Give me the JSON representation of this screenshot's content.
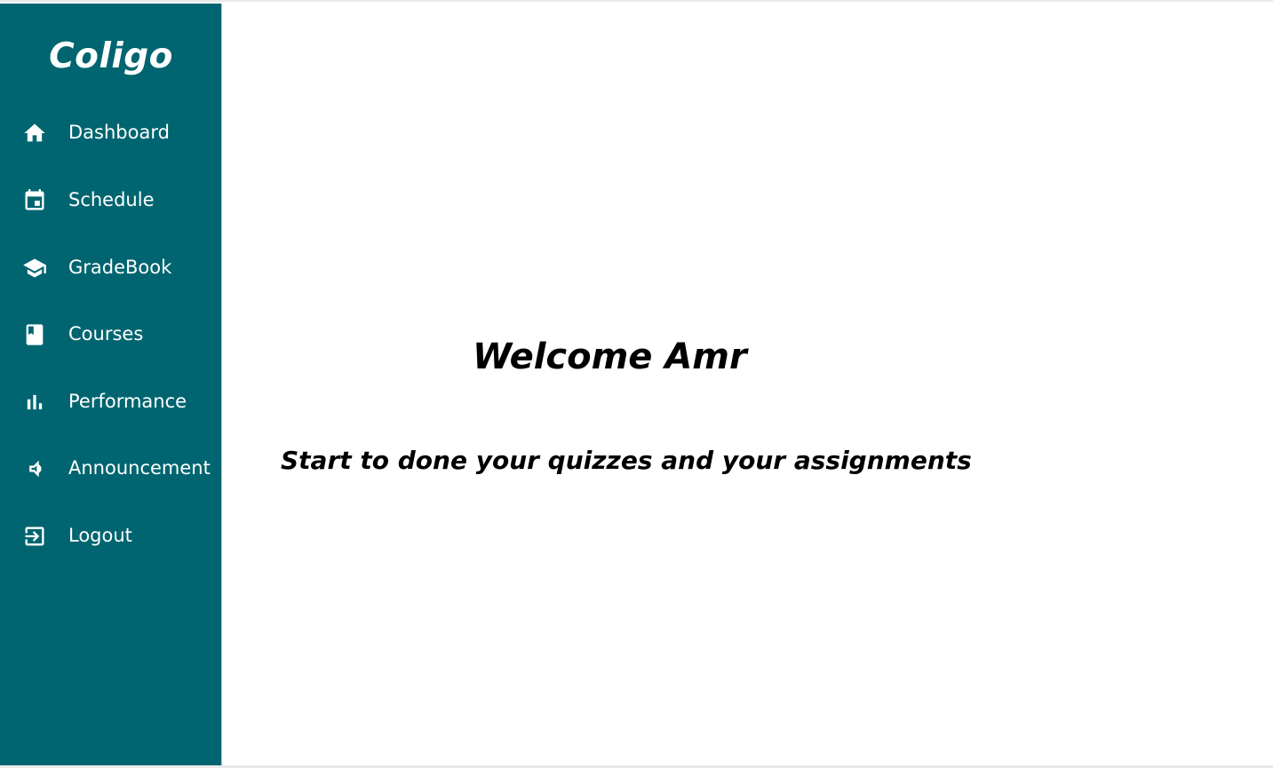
{
  "brand": {
    "name": "Coligo"
  },
  "sidebar": {
    "items": [
      {
        "label": "Dashboard",
        "icon": "home-icon"
      },
      {
        "label": "Schedule",
        "icon": "calendar-icon"
      },
      {
        "label": "GradeBook",
        "icon": "graduation-cap-icon"
      },
      {
        "label": "Courses",
        "icon": "book-icon"
      },
      {
        "label": "Performance",
        "icon": "bar-chart-icon"
      },
      {
        "label": "Announcement",
        "icon": "speaker-icon"
      },
      {
        "label": "Logout",
        "icon": "logout-icon"
      }
    ]
  },
  "main": {
    "welcome": "Welcome Amr",
    "subtitle": "Start to done your quizzes and your assignments"
  },
  "colors": {
    "sidebar_bg": "#006570",
    "sidebar_text": "#ffffff",
    "main_bg": "#ffffff",
    "main_text": "#000000"
  }
}
